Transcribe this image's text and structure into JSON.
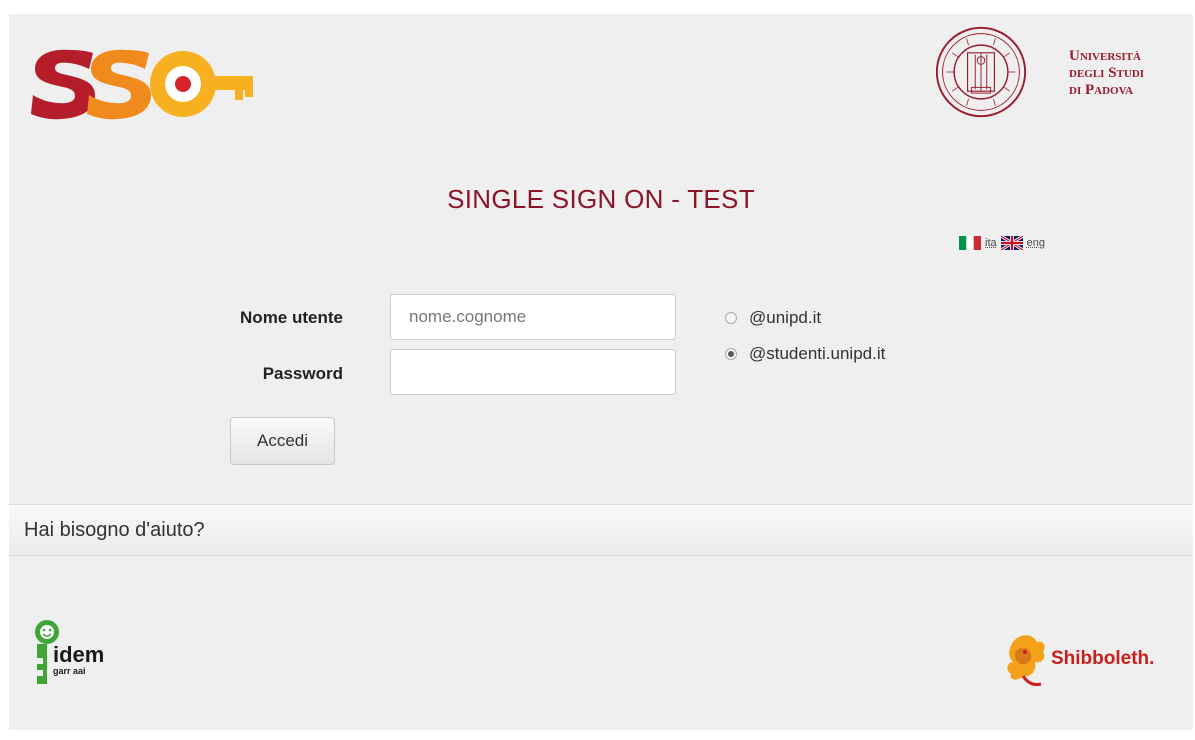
{
  "header": {
    "logo_text": "SSO",
    "university_lines": [
      "Università",
      "degli Studi",
      "di Padova"
    ],
    "seal_label": "Università degli Studi di Padova seal"
  },
  "title": "SINGLE SIGN ON - TEST",
  "languages": [
    {
      "code": "ita",
      "label": "ita",
      "flag": "italy-flag-icon"
    },
    {
      "code": "eng",
      "label": "eng",
      "flag": "uk-flag-icon"
    }
  ],
  "form": {
    "username_label": "Nome utente",
    "username_placeholder": "nome.cognome",
    "username_value": "",
    "password_label": "Password",
    "password_value": "",
    "domains": [
      {
        "label": "@unipd.it",
        "checked": false
      },
      {
        "label": "@studenti.unipd.it",
        "checked": true
      }
    ],
    "submit_label": "Accedi"
  },
  "help": {
    "label": "Hai bisogno d'aiuto?"
  },
  "footer": {
    "idem_text": "idem",
    "idem_subtext": "garr aai",
    "shibboleth_text": "Shibboleth."
  },
  "colors": {
    "accent": "#8a1528",
    "sso_dark_red": "#b51d2a",
    "sso_orange": "#f08a1c",
    "sso_yellow": "#f6b020",
    "idem_green": "#3fa535",
    "shibboleth_red": "#c8201e"
  }
}
